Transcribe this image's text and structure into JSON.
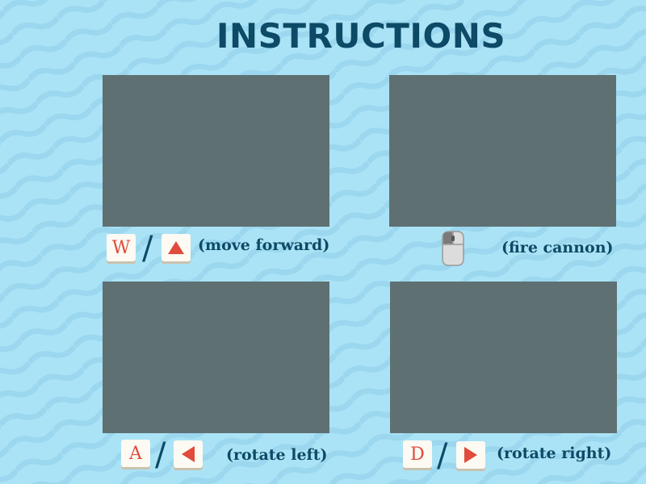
{
  "title": "INSTRUCTIONS",
  "colors": {
    "background": "#abe3f6",
    "wave": "#9bd7ee",
    "panel": "#5f7073",
    "text": "#0c4a66",
    "key_glyph": "#e04b3c",
    "key_face": "#fcfaf3"
  },
  "controls": {
    "forward": {
      "key": "W",
      "arrow_icon": "arrow-up-icon",
      "separator": "/",
      "label": "(move  forward)"
    },
    "fire": {
      "input_icon": "mouse-icon",
      "label": "(fire cannon)"
    },
    "left": {
      "key": "A",
      "arrow_icon": "arrow-left-icon",
      "separator": "/",
      "label": "(rotate left)"
    },
    "right": {
      "key": "D",
      "arrow_icon": "arrow-right-icon",
      "separator": "/",
      "label": "(rotate right)"
    }
  }
}
